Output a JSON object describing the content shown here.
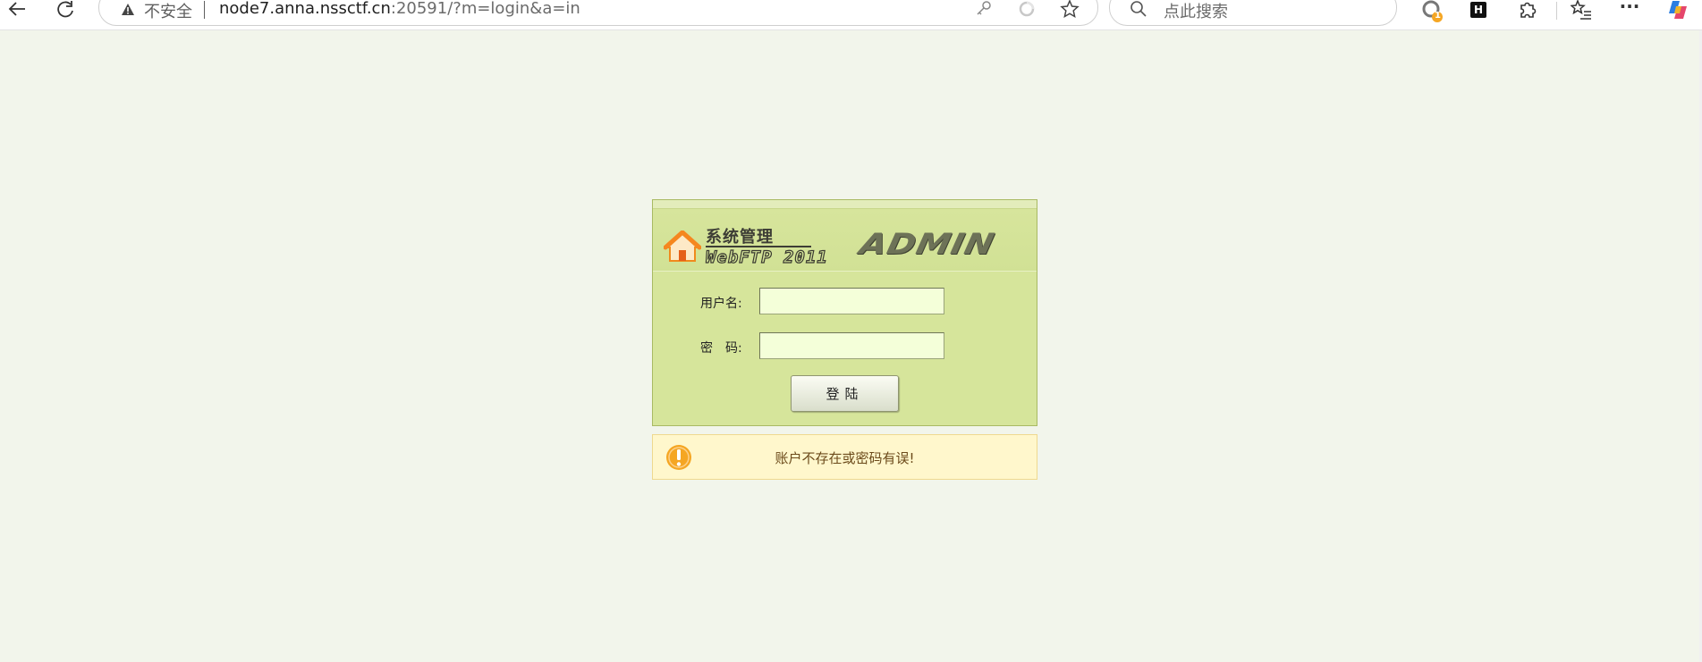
{
  "browser": {
    "security_label": "不安全",
    "url_host": "node7.anna.nssctf.cn",
    "url_path": ":20591/?m=login&a=in",
    "search_placeholder": "点此搜索",
    "extension_badge": "1",
    "extension_h_label": "H",
    "more_label": "···"
  },
  "login": {
    "system_title": "系统管理",
    "product_name": "WebFTP 2011",
    "admin_logo": "ADMIN",
    "username_label": "用户名:",
    "username_value": "",
    "password_label": "密　码:",
    "password_value": "",
    "submit_label": "登陆"
  },
  "error": {
    "message": "账户不存在或密码有误!"
  },
  "colors": {
    "page_bg": "#f2f5eb",
    "login_bg": "#d6e59b",
    "input_bg": "#f4ffd9",
    "error_bg": "#fff7cc",
    "error_icon": "#f5a623"
  }
}
